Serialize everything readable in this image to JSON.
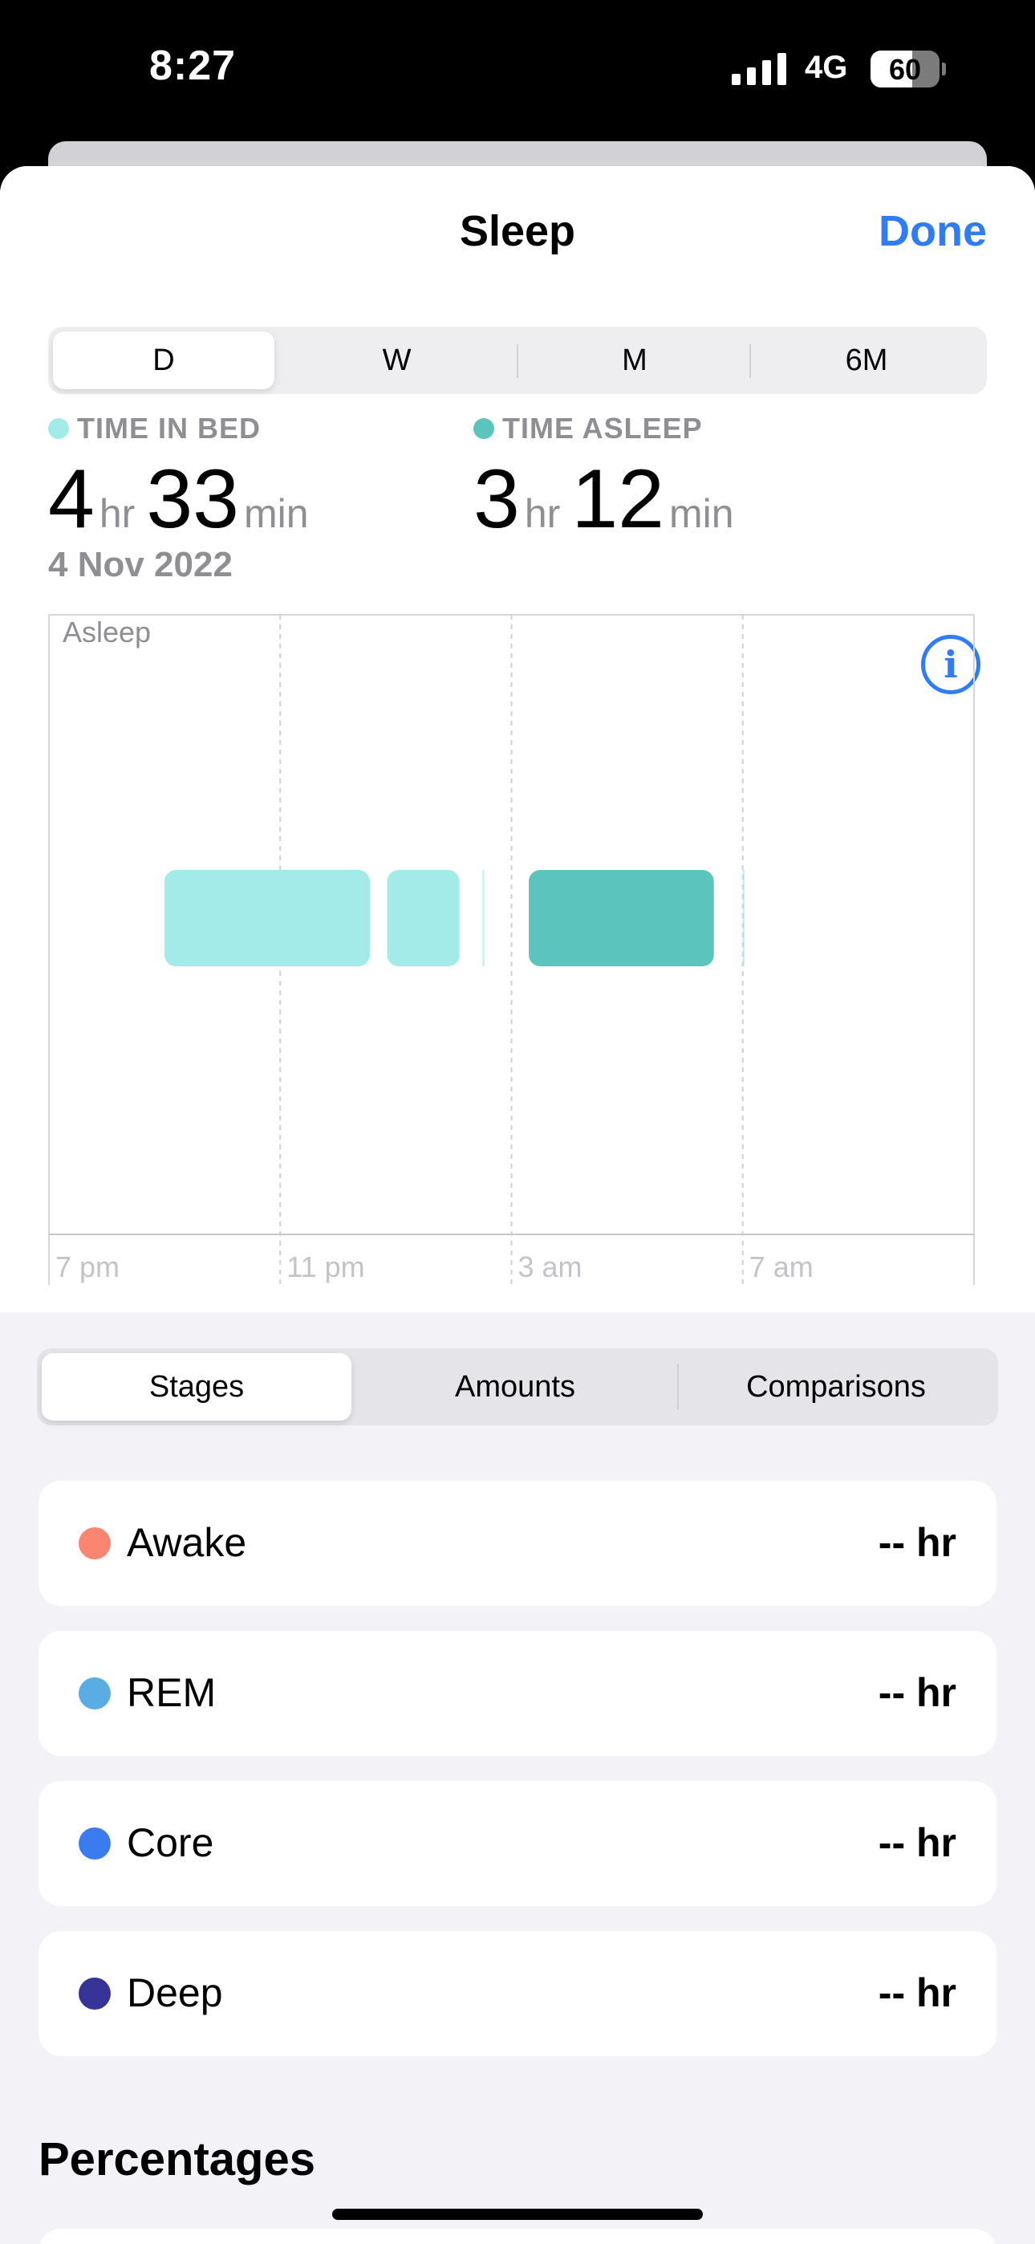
{
  "status_bar": {
    "time": "8:27",
    "network": "4G",
    "battery": "60",
    "battery_level": 0.6
  },
  "nav": {
    "title": "Sleep",
    "done_label": "Done"
  },
  "range_tabs": [
    {
      "label": "D",
      "selected": true
    },
    {
      "label": "W",
      "selected": false
    },
    {
      "label": "M",
      "selected": false
    },
    {
      "label": "6M",
      "selected": false
    }
  ],
  "summary": {
    "time_in_bed": {
      "label": "TIME IN BED",
      "hours": "4",
      "hr_unit": "hr",
      "minutes": "33",
      "min_unit": "min",
      "color": "#a3ebe8"
    },
    "time_asleep": {
      "label": "TIME ASLEEP",
      "hours": "3",
      "hr_unit": "hr",
      "minutes": "12",
      "min_unit": "min",
      "color": "#5bc4bc"
    },
    "date": "4 Nov 2022",
    "info_icon": "info-icon"
  },
  "chart_data": {
    "type": "bar",
    "ylabel": "Asleep",
    "x_ticks": [
      "7 pm",
      "11 pm",
      "3 am",
      "7 am"
    ],
    "x_range_hours": [
      19,
      35
    ],
    "series": [
      {
        "name": "TIME IN BED",
        "color": "#a3ebe8",
        "segments": [
          [
            21.0,
            24.55
          ],
          [
            24.85,
            26.1
          ],
          [
            26.5,
            26.53
          ],
          [
            31.0,
            31.03
          ]
        ]
      },
      {
        "name": "TIME ASLEEP",
        "color": "#5bc4bc",
        "segments": [
          [
            27.3,
            30.5
          ]
        ]
      }
    ],
    "grid": true
  },
  "view_tabs": [
    {
      "label": "Stages",
      "selected": true
    },
    {
      "label": "Amounts",
      "selected": false
    },
    {
      "label": "Comparisons",
      "selected": false
    }
  ],
  "stages": [
    {
      "label": "Awake",
      "value": "-- hr",
      "color": "#fa8672"
    },
    {
      "label": "REM",
      "value": "-- hr",
      "color": "#5aade3"
    },
    {
      "label": "Core",
      "value": "-- hr",
      "color": "#3a7cf0"
    },
    {
      "label": "Deep",
      "value": "-- hr",
      "color": "#363497"
    }
  ],
  "section_title": "Percentages"
}
